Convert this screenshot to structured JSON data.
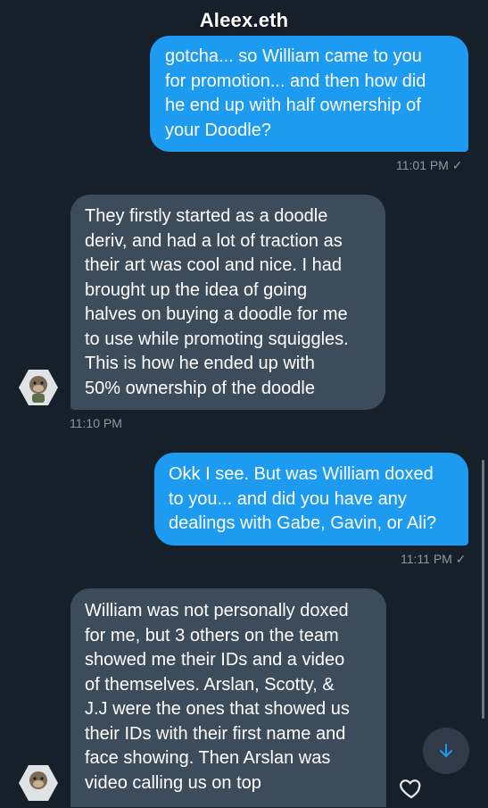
{
  "header": {
    "title": "Aleex.eth"
  },
  "messages": [
    {
      "text": "gotcha... so William came to you\nfor promotion... and then how did\nhe end up with half ownership of\nyour Doodle?",
      "time": "11:01 PM ✓"
    },
    {
      "text": "They firstly started as a doodle\nderiv, and had a lot of traction as\ntheir art was cool and nice. I had\nbrought up the idea of going\nhalves on buying a doodle for me\nto use while promoting squiggles.\nThis is how he ended up with\n50% ownership of the doodle",
      "time": "11:10 PM"
    },
    {
      "text": "Okk I see. But was William doxed\nto you... and did you have any\ndealings with Gabe, Gavin, or Ali?",
      "time": "11:11 PM ✓"
    },
    {
      "text": "William was not personally doxed\nfor me, but 3 others on the team\nshowed me their IDs and a video\nof themselves. Arslan, Scotty, &\nJ.J were the ones that showed us\ntheir IDs with their first name and\nface showing. Then Arslan was\nvideo calling us on top"
    }
  ],
  "icons": {
    "scroll_down": "arrow-down-icon",
    "react": "heart-icon",
    "avatar": "ape-avatar"
  },
  "colors": {
    "background": "#15202b",
    "outgoing_bubble": "#1d9bf0",
    "incoming_bubble": "#3d4c5b",
    "timestamp": "#8b98a5"
  }
}
